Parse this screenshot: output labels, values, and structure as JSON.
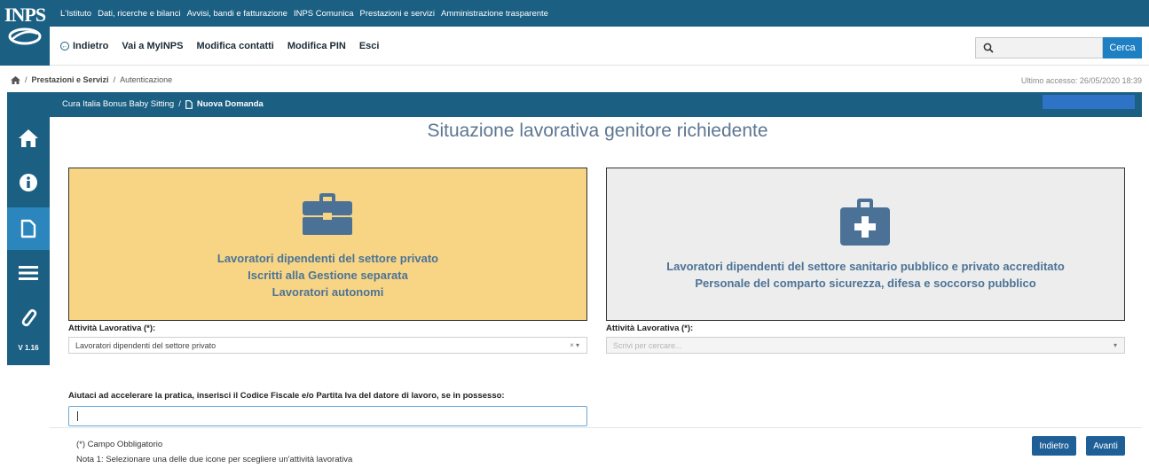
{
  "brand": {
    "logo_text": "INPS"
  },
  "top_links": [
    "L'Istituto",
    "Dati, ricerche e bilanci",
    "Avvisi, bandi e fatturazione",
    "INPS Comunica",
    "Prestazioni e servizi",
    "Amministrazione trasparente"
  ],
  "nav": {
    "back": "Indietro",
    "myinps": "Vai a MyINPS",
    "contacts": "Modifica contatti",
    "pin": "Modifica PIN",
    "exit": "Esci"
  },
  "search": {
    "value": "",
    "button": "Cerca"
  },
  "breadcrumb": {
    "sep": "/",
    "item1": "Prestazioni e Servizi",
    "item2": "Autenticazione"
  },
  "last_access": "Ultimo accesso: 26/05/2020 18:39",
  "sidebar": {
    "version": "V 1.16"
  },
  "mainbar": {
    "crumb1": "Cura Italia Bonus Baby Sitting",
    "sep": "/",
    "crumb2": "Nuova Domanda"
  },
  "page_title": "Situazione lavorativa genitore richiedente",
  "card_left": {
    "line1": "Lavoratori dipendenti del settore privato",
    "line2": "Iscritti alla Gestione separata",
    "line3": "Lavoratori autonomi"
  },
  "card_right": {
    "line1": "Lavoratori dipendenti del settore sanitario pubblico e privato accreditato",
    "line2": "Personale del comparto sicurezza, difesa e soccorso pubblico"
  },
  "field_left": {
    "label": "Attività Lavorativa (*):",
    "value": "Lavoratori dipendenti del settore privato"
  },
  "field_right": {
    "label": "Attività Lavorativa (*):",
    "placeholder": "Scrivi per cercare..."
  },
  "cf": {
    "label": "Aiutaci ad accelerare la pratica, inserisci il Codice Fiscale e/o Partita Iva del datore di lavoro, se in possesso:",
    "value": ""
  },
  "notes": {
    "required": "(*) Campo Obbligatorio",
    "note1": "Nota 1: Selezionare una delle due icone per scegliere un'attività lavorativa"
  },
  "buttons": {
    "back": "Indietro",
    "next": "Avanti"
  },
  "colors": {
    "primary": "#1b5f83",
    "card_selected": "#f8d585",
    "card_unselected": "#ededed",
    "button": "#1f5f97"
  }
}
